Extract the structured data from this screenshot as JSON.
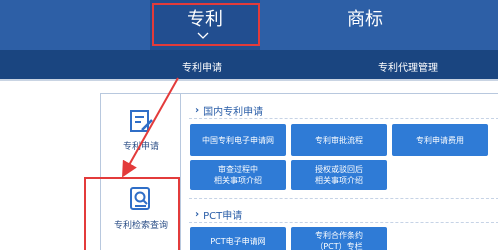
{
  "topnav": {
    "patent_label": "专利",
    "trademark_label": "商标"
  },
  "subnav": {
    "apply_label": "专利申请",
    "agent_label": "专利代理管理"
  },
  "sidebar": {
    "online_label": "专利申请",
    "search_label": "专利检索查询"
  },
  "domestic": {
    "title": "国内专利申请",
    "buttons": [
      "中国专利电子申请网",
      "专利审批流程",
      "专利申请费用",
      "审查过程中\n相关事项介绍",
      "授权或驳回后\n相关事项介绍"
    ]
  },
  "pct": {
    "title": "PCT申请",
    "buttons": [
      "PCT电子申请网",
      "专利合作条约\n（PCT）专栏"
    ]
  },
  "colors": {
    "nav_blue": "#2d5fa6",
    "subnav_blue": "#1a4580",
    "button_blue": "#2f7bd6",
    "annotation_red": "#e33b3b"
  }
}
